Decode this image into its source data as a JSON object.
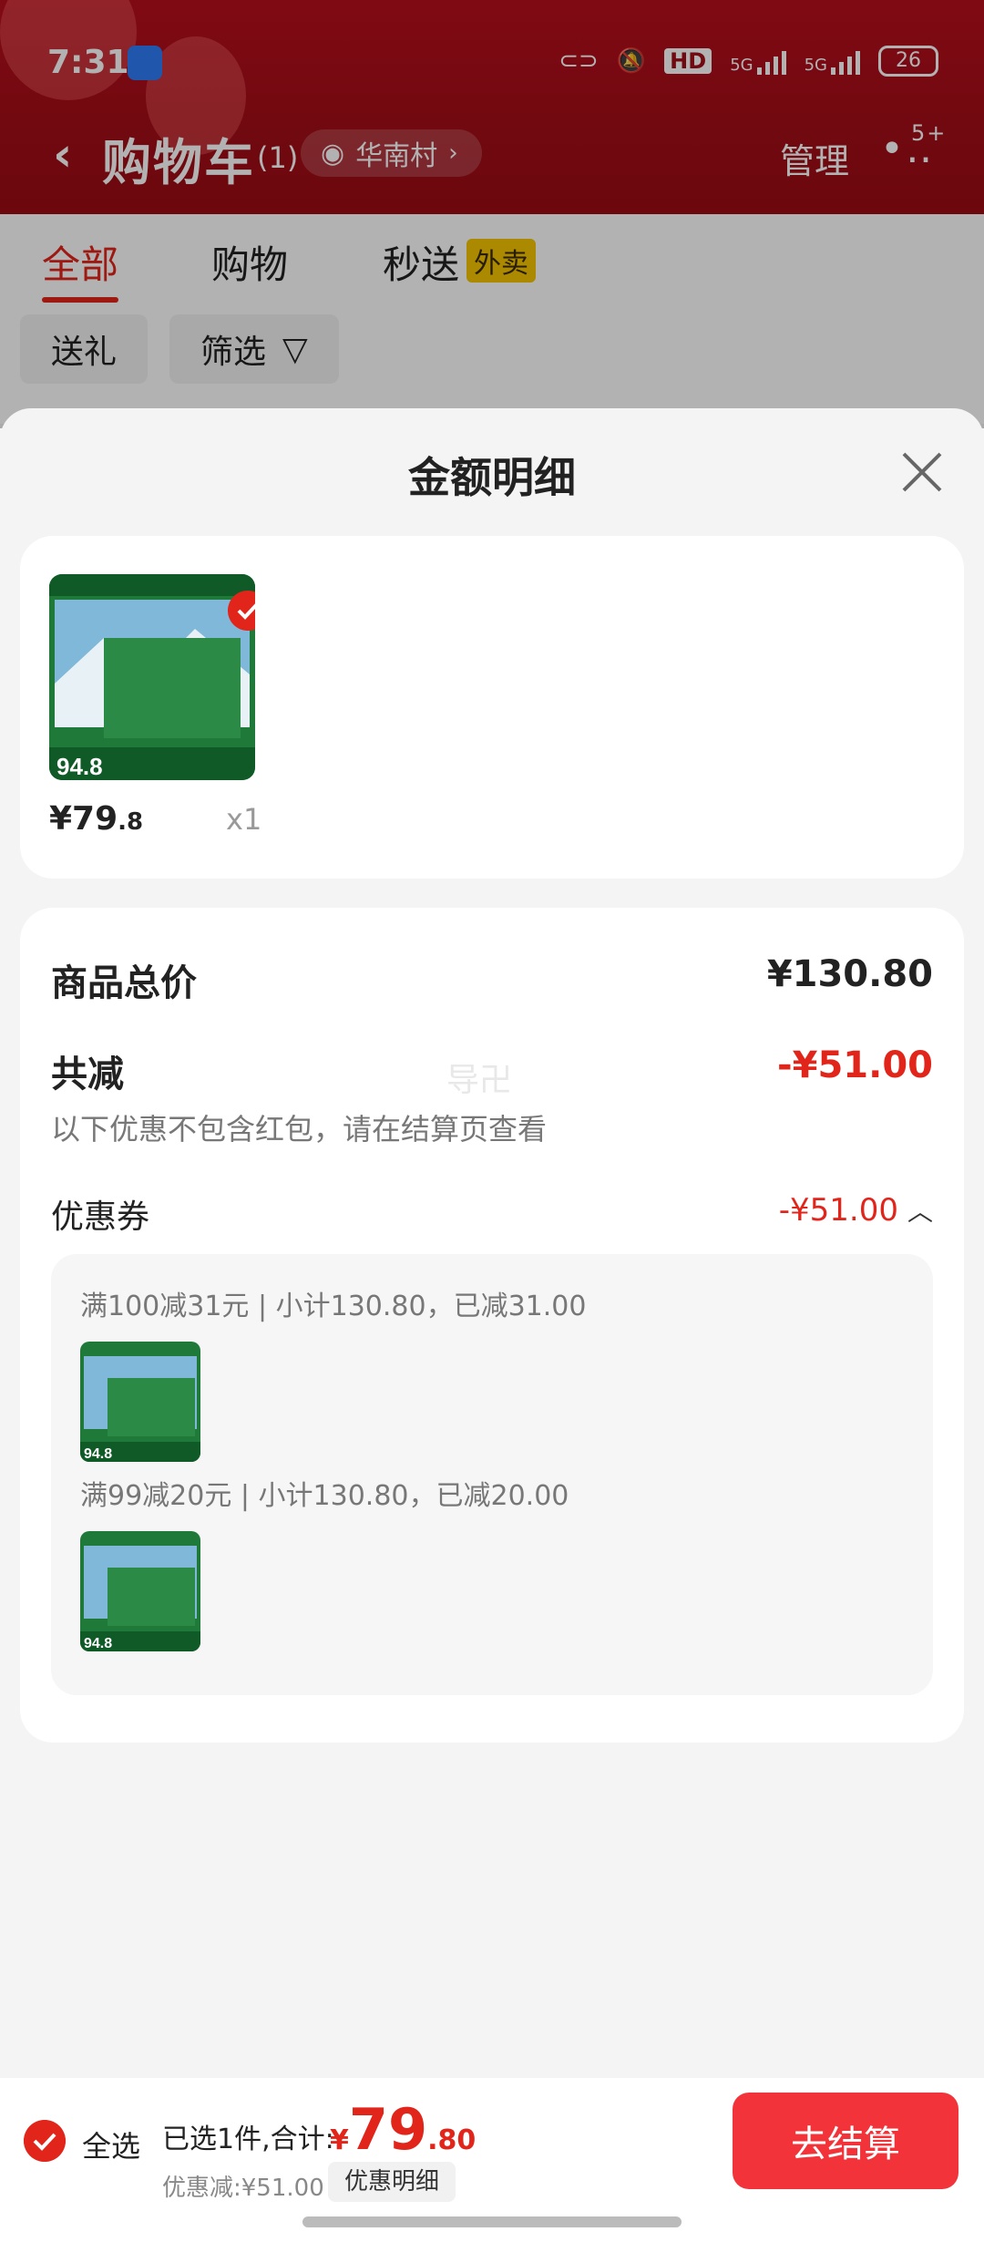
{
  "status_bar": {
    "time": "7:31",
    "net_5g_a": "5G",
    "net_5g_b": "5G",
    "battery": "26",
    "hd_label": "HD"
  },
  "header": {
    "title": "购物车",
    "count": "(1)",
    "location": "华南村",
    "manage": "管理",
    "more_badge": "5+"
  },
  "tabs": [
    {
      "label": "全部"
    },
    {
      "label": "购物"
    },
    {
      "label": "秒送"
    }
  ],
  "waimai_tag": "外卖",
  "chips": [
    {
      "label": "送礼"
    },
    {
      "label": "筛选"
    }
  ],
  "sheet": {
    "title": "金额明细",
    "item": {
      "price_int": "¥79",
      "price_frac": ".8",
      "qty": "x1",
      "img_badge": "94.8"
    },
    "total_label": "商品总价",
    "total_value": "¥130.80",
    "reduce_label": "共减",
    "reduce_value": "-¥51.00",
    "reduce_note": "以下优惠不包含红包，请在结算页查看",
    "coupon_label": "优惠券",
    "coupon_value": "-¥51.00",
    "watermark": "导卍",
    "rules": [
      {
        "text": "满100减31元 | 小计130.80，已减31.00",
        "badge": "94.8"
      },
      {
        "text": "满99减20元 | 小计130.80，已减20.00",
        "badge": "94.8"
      }
    ]
  },
  "bottom": {
    "select_all": "全选",
    "summary": "已选1件,合计:",
    "price_yen": "¥",
    "price_int": "79",
    "price_dec": ".80",
    "discount": "优惠减:¥51.00",
    "detail_btn": "优惠明细",
    "checkout": "去结算"
  },
  "colors": {
    "brand_red": "#e1251b",
    "header_red": "#a30d17",
    "checkout_red": "#f2333a",
    "product_green": "#1f7a3a"
  }
}
